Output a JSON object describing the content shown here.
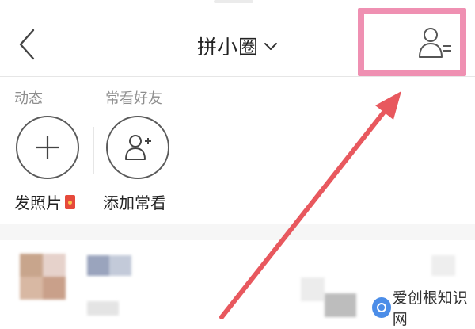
{
  "header": {
    "title": "拼小圈",
    "back_icon": "chevron-left-icon",
    "dropdown_icon": "chevron-down-icon",
    "friends_icon": "friends-list-icon"
  },
  "sections": {
    "dynamic_label": "动态",
    "frequent_friends_label": "常看好友"
  },
  "actions": {
    "post_photo_label": "发照片",
    "add_frequent_label": "添加常看"
  },
  "watermark": {
    "text": "爱创根知识网"
  },
  "colors": {
    "highlight_border": "#ef90b2",
    "arrow": "#e8585e",
    "badge": "#e64a3b"
  }
}
